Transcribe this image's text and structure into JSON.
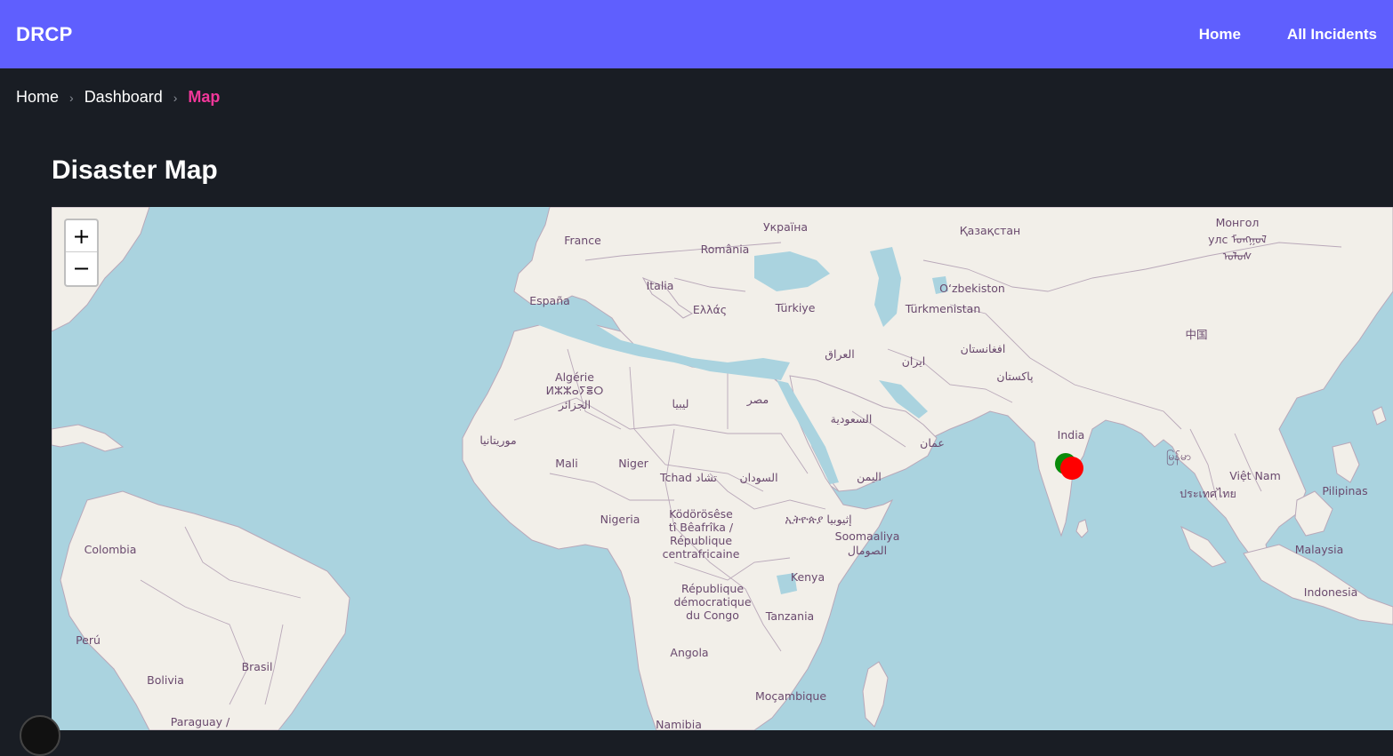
{
  "navbar": {
    "brand": "DRCP",
    "links": [
      "Home",
      "All Incidents"
    ]
  },
  "breadcrumb": {
    "items": [
      "Home",
      "Dashboard",
      "Map"
    ]
  },
  "page": {
    "title": "Disaster Map"
  },
  "map": {
    "zoom_in": "+",
    "zoom_out": "−",
    "colors": {
      "water": "#aad3df",
      "land": "#f2efe9",
      "border": "#b9a8b9",
      "label": "#6a4a6e"
    },
    "labels": {
      "france": "France",
      "ukraine": "Україна",
      "kazakhstan": "Қазақстан",
      "mongolia1": "Монгол",
      "mongolia2": "улс ᠮᠣᠩᠭᠣᠯ",
      "mongolia3": "ᠤᠯᠤᠰ",
      "romania": "România",
      "italia": "Italia",
      "espana": "España",
      "uzbekistan": "O‘zbekiston",
      "ellas": "Ελλάς",
      "turkiye": "Türkiye",
      "turkmenistan": "Türkmenistan",
      "china": "中国",
      "iraq": "العراق",
      "afghanistan": "افغانستان",
      "iran": "ایران",
      "pakistan": "پاکستان",
      "algeria1": "Algérie",
      "algeria2": "ⵍⵣⵣⴰⵢⴻⵔ",
      "algeria3": "الجزائر",
      "libya": "ليبيا",
      "egypt": "مصر",
      "saudi": "السعودية",
      "india": "India",
      "mauritania": "موريتانيا",
      "oman": "عمان",
      "mali": "Mali",
      "niger": "Niger",
      "myanmar": "မြန်မာ",
      "vietnam": "Việt Nam",
      "tchad": "Tchad تشاد",
      "sudan": "السودان",
      "yemen": "اليمن",
      "pilipinas": "Pilipinas",
      "thailand": "ประเทศไทย",
      "nigeria": "Nigeria",
      "car1": "Ködörösêse",
      "car2": "tî Bêafrîka /",
      "car3": "République",
      "car4": "centrafricaine",
      "ethiopia": "ኢትዮጵያ إثيوبيا",
      "somalia1": "Soomaaliya",
      "somalia2": "الصومال",
      "colombia": "Colombia",
      "malaysia": "Malaysia",
      "kenya": "Kenya",
      "drc1": "République",
      "drc2": "démocratique",
      "drc3": "du Congo",
      "indonesia": "Indonesia",
      "tanzania": "Tanzania",
      "peru": "Perú",
      "angola": "Angola",
      "brasil": "Brasil",
      "bolivia": "Bolivia",
      "mozambique": "Moçambique",
      "paraguay": "Paraguay /",
      "namibia": "Namibia"
    },
    "markers": [
      {
        "name": "incident-marker-green",
        "color": "#0a8a0a"
      },
      {
        "name": "incident-marker-red",
        "color": "#ff0000"
      }
    ]
  }
}
